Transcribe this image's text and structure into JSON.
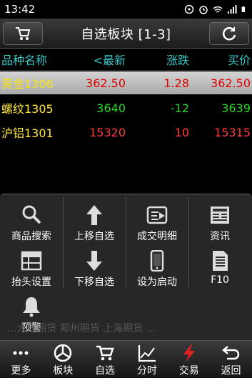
{
  "status": {
    "time": "13:42"
  },
  "header": {
    "title": "自选板块 [1-3]"
  },
  "columns": {
    "name": "品种名称",
    "latest": "<最新",
    "change": "涨跌",
    "bid": "买价"
  },
  "rows": [
    {
      "name": "黄金1306",
      "latest": "362.50",
      "change": "1.28",
      "bid": "362.50",
      "trend": "up",
      "selected": true
    },
    {
      "name": "螺纹1305",
      "latest": "3640",
      "change": "-12",
      "bid": "3639",
      "trend": "down",
      "selected": false
    },
    {
      "name": "沪铝1301",
      "latest": "15320",
      "change": "10",
      "bid": "15315",
      "trend": "up",
      "selected": false
    }
  ],
  "menu": [
    {
      "label": "商品搜索",
      "icon": "search-icon"
    },
    {
      "label": "上移自选",
      "icon": "arrow-up-icon"
    },
    {
      "label": "成交明细",
      "icon": "trade-detail-icon"
    },
    {
      "label": "资讯",
      "icon": "news-icon"
    },
    {
      "label": "抬头设置",
      "icon": "table-header-icon"
    },
    {
      "label": "下移自选",
      "icon": "arrow-down-icon"
    },
    {
      "label": "设为启动",
      "icon": "phone-icon"
    },
    {
      "label": "F10",
      "icon": "document-icon"
    },
    {
      "label": "预警",
      "icon": "bell-icon"
    }
  ],
  "ticker": "...大连期货 郑州期货 上海期货 ...",
  "nav": [
    {
      "label": "更多",
      "icon": "more-icon"
    },
    {
      "label": "板块",
      "icon": "sector-icon"
    },
    {
      "label": "自选",
      "icon": "cart-icon"
    },
    {
      "label": "分时",
      "icon": "timeshare-icon"
    },
    {
      "label": "交易",
      "icon": "lightning-icon"
    },
    {
      "label": "返回",
      "icon": "back-icon"
    }
  ],
  "colors": {
    "up": "#ff3b3b",
    "down": "#22d622",
    "name": "#ffe83a",
    "column_header": "#38c6c6",
    "trade_icon": "#e02020"
  }
}
